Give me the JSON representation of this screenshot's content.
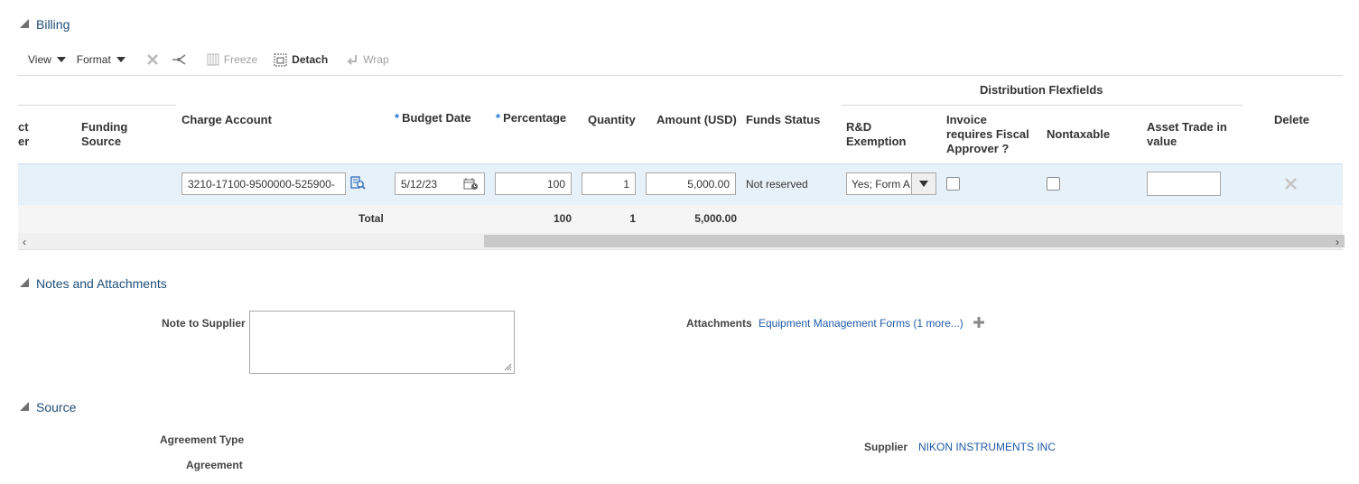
{
  "billing": {
    "title": "Billing",
    "toolbar": {
      "view": "View",
      "format": "Format",
      "freeze": "Freeze",
      "detach": "Detach",
      "wrap": "Wrap"
    },
    "group_header": "Distribution Flexfields",
    "columns": {
      "project_number_partial_1": "ct",
      "project_number_partial_2": "er",
      "funding_source_1": "Funding",
      "funding_source_2": "Source",
      "charge_account": "Charge Account",
      "budget_date": "Budget Date",
      "percentage": "Percentage",
      "quantity": "Quantity",
      "amount": "Amount (USD)",
      "funds_status": "Funds Status",
      "rd_exemption_1": "R&D",
      "rd_exemption_2": "Exemption",
      "invoice_fiscal_1": "Invoice",
      "invoice_fiscal_2": "requires Fiscal",
      "invoice_fiscal_3": "Approver ?",
      "nontaxable": "Nontaxable",
      "asset_trade_1": "Asset Trade in",
      "asset_trade_2": "value",
      "delete": "Delete",
      "required_marker": "*"
    },
    "row": {
      "charge_account": "3210-17100-9500000-525900-",
      "budget_date": "5/12/23",
      "percentage": "100",
      "quantity": "1",
      "amount": "5,000.00",
      "funds_status": "Not reserved",
      "rd_exemption": "Yes; Form A",
      "invoice_requires_fiscal_approver": false,
      "nontaxable": false,
      "asset_trade_in_value": ""
    },
    "totals": {
      "label": "Total",
      "percentage": "100",
      "quantity": "1",
      "amount": "5,000.00"
    }
  },
  "notes": {
    "title": "Notes and Attachments",
    "note_to_supplier_label": "Note to Supplier",
    "note_to_supplier_value": "",
    "attachments_label": "Attachments",
    "attachments_link": "Equipment Management Forms (1 more...)"
  },
  "source": {
    "title": "Source",
    "agreement_type_label": "Agreement Type",
    "agreement_label": "Agreement",
    "supplier_label": "Supplier",
    "supplier_value": "NIKON INSTRUMENTS INC"
  },
  "icons": {
    "collapse": "triangle-down-left",
    "clear": "x-icon",
    "split": "split-icon",
    "freeze": "freeze-icon",
    "detach": "detach-icon",
    "wrap": "wrap-icon",
    "search": "search-list-icon",
    "calendar": "calendar-icon",
    "dropdown": "chevron-down-icon",
    "delete": "x-icon",
    "add": "plus-icon"
  },
  "colors": {
    "section_title": "#1f4e79",
    "link": "#1f5aa6",
    "selected_row": "#e7f1fa",
    "required": "#1f7ad0"
  }
}
